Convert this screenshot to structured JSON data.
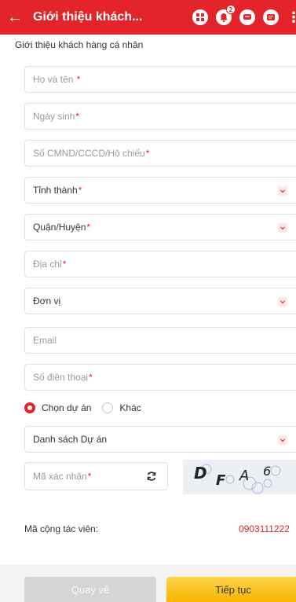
{
  "header": {
    "title": "Giới thiệu khách...",
    "notification_count": "2",
    "bg_color": "#e3242b"
  },
  "form": {
    "section_title": "Giới thiệu khách hàng cá nhân",
    "fields": {
      "full_name": "Họ và tên",
      "birth_date": "Ngày sinh",
      "id_number": "Số CMND/CCCD/Hộ chiếu",
      "province": "Tỉnh thành",
      "district": "Quận/Huyện",
      "address": "Địa chỉ",
      "unit": "Đơn vị",
      "email": "Email",
      "phone": "Số điện thoại",
      "project_list": "Danh sách Dự án",
      "captcha": "Mã xác nhận"
    },
    "required_mark": "*",
    "radio": {
      "choose_project": "Chọn dự án",
      "other": "Khác",
      "selected": "choose_project"
    },
    "captcha_text": [
      "D",
      "F",
      "A",
      "6"
    ]
  },
  "collaborator": {
    "label": "Mã cộng tác viên:",
    "value": "0903111222"
  },
  "footer": {
    "back_label": "Quay về",
    "next_label": "Tiếp tục"
  }
}
